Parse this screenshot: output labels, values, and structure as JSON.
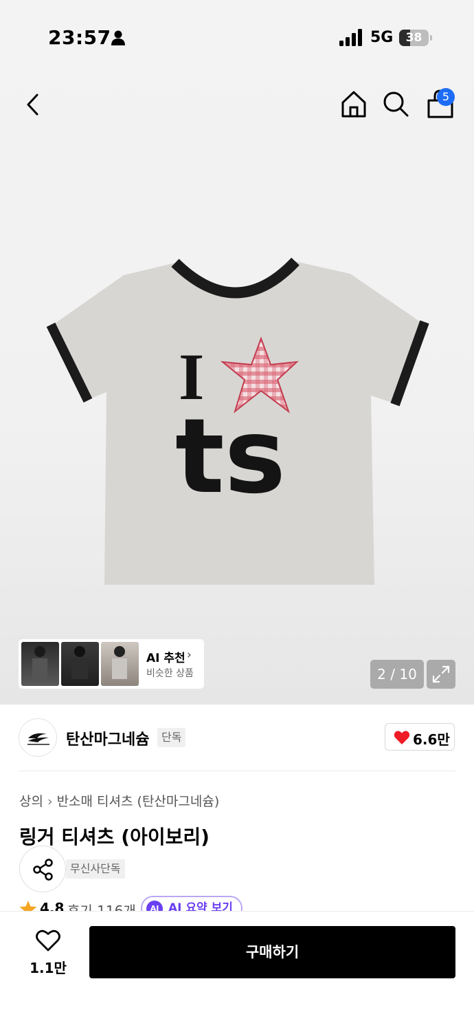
{
  "status_bar": {
    "time": "23:57",
    "network": "5G",
    "battery": "38",
    "battery_level": 0.38
  },
  "header": {
    "cart_count": "5"
  },
  "ai_recommend": {
    "title": "AI 추천",
    "subtitle": "비슷한 상품"
  },
  "gallery": {
    "counter": "2 / 10"
  },
  "brand": {
    "name": "탄산마그네슘",
    "tag": "단독",
    "like_count": "6.6만"
  },
  "breadcrumb": {
    "category": "상의",
    "subcategory": "반소매 티셔츠 (탄산마그네슘)"
  },
  "product": {
    "title": "링거 티셔츠 (아이보리)",
    "exclusive_tag": "무신사단독",
    "rating": "4.8",
    "review_count": "후기 116개",
    "ai_summary_label": "AI 요약 보기",
    "ai_badge": "AI"
  },
  "bottom": {
    "wish_count": "1.1만",
    "buy_label": "구매하기"
  },
  "colors": {
    "accent_blue": "#1e6cf5",
    "heart_red": "#ee1c25",
    "ai_purple": "#6a3ff2",
    "buy_button": "#000000"
  },
  "icons": [
    "back-icon",
    "home-icon",
    "search-icon",
    "cart-icon",
    "expand-icon",
    "heart-icon",
    "share-icon",
    "star-icon"
  ]
}
